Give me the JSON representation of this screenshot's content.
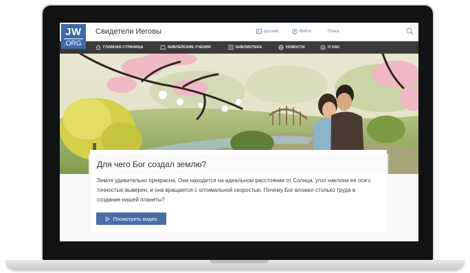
{
  "header": {
    "logo_line1": "JW",
    "logo_line2": ".ORG",
    "site_title": "Свидетели Иеговы",
    "language": "русский",
    "login": "Войти",
    "search_label": "Поиск"
  },
  "nav": {
    "items": [
      {
        "label": "ГЛАВНАЯ СТРАНИЦА",
        "icon": "home-icon"
      },
      {
        "label": "БИБЛЕЙСКИЕ УЧЕНИЯ",
        "icon": "bible-icon"
      },
      {
        "label": "БИБЛИОТЕКА",
        "icon": "library-icon"
      },
      {
        "label": "НОВОСТИ",
        "icon": "globe-icon"
      },
      {
        "label": "О НАС",
        "icon": "people-icon"
      }
    ]
  },
  "feature": {
    "heading": "Для чего Бог создал землю?",
    "body": "Земля удивительно прекрасна. Она находится на идеальном расстоянии от Солнца, угол наклона ее оси с точностью выверен, и она вращается с оптимальной скоростью. Почему Бог вложил столько труда в создание нашей планеты?",
    "button_label": "Посмотреть видео"
  },
  "colors": {
    "brand_blue": "#3d6aa8",
    "nav_bg": "#3b3b3b",
    "button_bg": "#4a6da7"
  }
}
